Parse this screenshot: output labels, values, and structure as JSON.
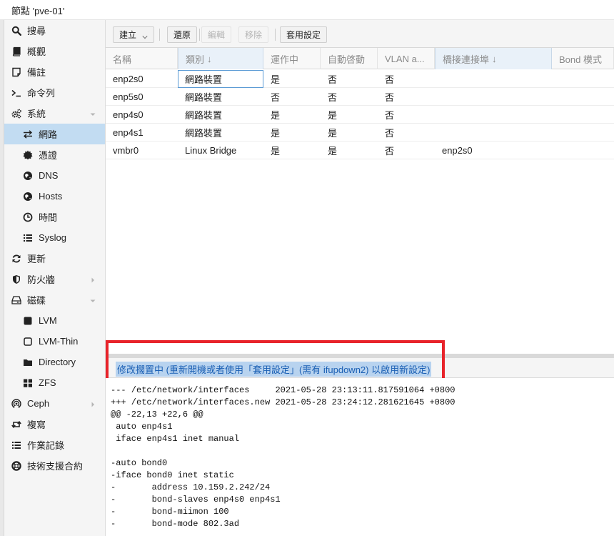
{
  "window": {
    "title": "節點 'pve-01'"
  },
  "sidebar": {
    "items": [
      {
        "label": "搜尋",
        "icon": "search-icon",
        "name": "sidebar-item-search",
        "level": 0,
        "active": false,
        "arrow": ""
      },
      {
        "label": "概觀",
        "icon": "book-icon",
        "name": "sidebar-item-summary",
        "level": 0,
        "active": false,
        "arrow": ""
      },
      {
        "label": "備註",
        "icon": "note-icon",
        "name": "sidebar-item-notes",
        "level": 0,
        "active": false,
        "arrow": ""
      },
      {
        "label": "命令列",
        "icon": "terminal-icon",
        "name": "sidebar-item-shell",
        "level": 0,
        "active": false,
        "arrow": ""
      },
      {
        "label": "系統",
        "icon": "cogs-icon",
        "name": "sidebar-item-system",
        "level": 0,
        "active": false,
        "arrow": "down"
      },
      {
        "label": "網路",
        "icon": "exchange-icon",
        "name": "sidebar-item-network",
        "level": 1,
        "active": true,
        "arrow": ""
      },
      {
        "label": "憑證",
        "icon": "certificate-icon",
        "name": "sidebar-item-certificates",
        "level": 1,
        "active": false,
        "arrow": ""
      },
      {
        "label": "DNS",
        "icon": "globe-icon",
        "name": "sidebar-item-dns",
        "level": 1,
        "active": false,
        "arrow": ""
      },
      {
        "label": "Hosts",
        "icon": "globe-icon",
        "name": "sidebar-item-hosts",
        "level": 1,
        "active": false,
        "arrow": ""
      },
      {
        "label": "時間",
        "icon": "clock-icon",
        "name": "sidebar-item-time",
        "level": 1,
        "active": false,
        "arrow": ""
      },
      {
        "label": "Syslog",
        "icon": "list-icon",
        "name": "sidebar-item-syslog",
        "level": 1,
        "active": false,
        "arrow": ""
      },
      {
        "label": "更新",
        "icon": "refresh-icon",
        "name": "sidebar-item-updates",
        "level": 0,
        "active": false,
        "arrow": ""
      },
      {
        "label": "防火牆",
        "icon": "shield-icon",
        "name": "sidebar-item-firewall",
        "level": 0,
        "active": false,
        "arrow": "right"
      },
      {
        "label": "磁碟",
        "icon": "hdd-icon",
        "name": "sidebar-item-disks",
        "level": 0,
        "active": false,
        "arrow": "down"
      },
      {
        "label": "LVM",
        "icon": "square-icon",
        "name": "sidebar-item-lvm",
        "level": 1,
        "active": false,
        "arrow": ""
      },
      {
        "label": "LVM-Thin",
        "icon": "square-outline-icon",
        "name": "sidebar-item-lvm-thin",
        "level": 1,
        "active": false,
        "arrow": ""
      },
      {
        "label": "Directory",
        "icon": "folder-icon",
        "name": "sidebar-item-directory",
        "level": 1,
        "active": false,
        "arrow": ""
      },
      {
        "label": "ZFS",
        "icon": "th-large-icon",
        "name": "sidebar-item-zfs",
        "level": 1,
        "active": false,
        "arrow": ""
      },
      {
        "label": "Ceph",
        "icon": "ceph-icon",
        "name": "sidebar-item-ceph",
        "level": 0,
        "active": false,
        "arrow": "right"
      },
      {
        "label": "複寫",
        "icon": "retweet-icon",
        "name": "sidebar-item-replication",
        "level": 0,
        "active": false,
        "arrow": ""
      },
      {
        "label": "作業記錄",
        "icon": "list-icon",
        "name": "sidebar-item-task-history",
        "level": 0,
        "active": false,
        "arrow": ""
      },
      {
        "label": "技術支援合約",
        "icon": "life-ring-icon",
        "name": "sidebar-item-subscription",
        "level": 0,
        "active": false,
        "arrow": ""
      }
    ]
  },
  "toolbar": {
    "create_label": "建立",
    "revert_label": "還原",
    "edit_label": "編輯",
    "remove_label": "移除",
    "apply_label": "套用設定"
  },
  "grid": {
    "columns": [
      "名稱",
      "類別",
      "運作中",
      "自動啓動",
      "VLAN a...",
      "橋接連接埠",
      "Bond 模式"
    ],
    "sorted_columns": [
      1,
      5
    ],
    "rows": [
      [
        "enp2s0",
        "網路裝置",
        "是",
        "否",
        "否",
        "",
        ""
      ],
      [
        "enp5s0",
        "網路裝置",
        "否",
        "否",
        "否",
        "",
        ""
      ],
      [
        "enp4s0",
        "網路裝置",
        "是",
        "是",
        "否",
        "",
        ""
      ],
      [
        "enp4s1",
        "網路裝置",
        "是",
        "是",
        "否",
        "",
        ""
      ],
      [
        "vmbr0",
        "Linux Bridge",
        "是",
        "是",
        "否",
        "enp2s0",
        ""
      ]
    ],
    "selected_cell": [
      0,
      1
    ]
  },
  "notice": {
    "text": "修改擱置中 (重新開機或者使用「套用設定」(需有 ifupdown2) 以啟用新設定)"
  },
  "diff": {
    "lines": [
      "--- /etc/network/interfaces     2021-05-28 23:13:11.817591064 +0800",
      "+++ /etc/network/interfaces.new 2021-05-28 23:24:12.281621645 +0800",
      "@@ -22,13 +22,6 @@",
      " auto enp4s1",
      " iface enp4s1 inet manual",
      "",
      "-auto bond0",
      "-iface bond0 inet static",
      "-       address 10.159.2.242/24",
      "-       bond-slaves enp4s0 enp4s1",
      "-       bond-miimon 100",
      "-       bond-mode 802.3ad"
    ]
  },
  "colors": {
    "accent": "#c2dcf2",
    "highlight": "#e8232a",
    "notice_text": "#1a5fb4"
  }
}
